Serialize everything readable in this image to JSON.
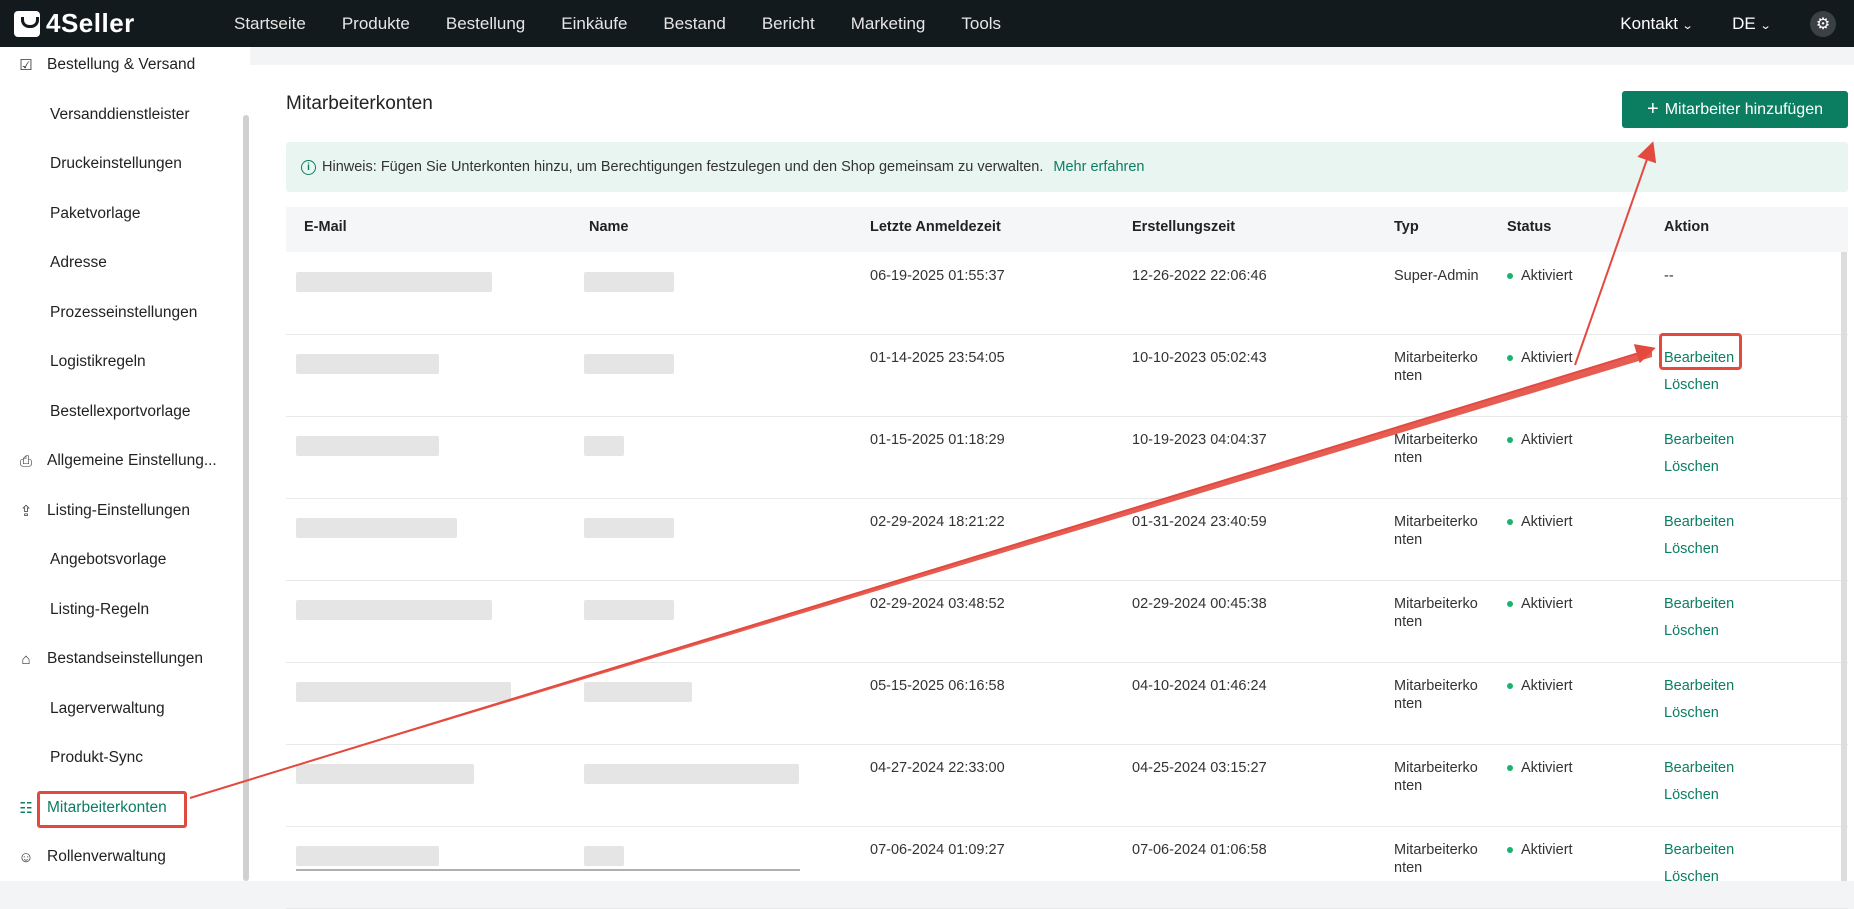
{
  "app": {
    "logo_text": "4Seller"
  },
  "topnav": {
    "items": [
      "Startseite",
      "Produkte",
      "Bestellung",
      "Einkäufe",
      "Bestand",
      "Bericht",
      "Marketing",
      "Tools"
    ],
    "contact": "Kontakt",
    "language": "DE"
  },
  "sidebar": {
    "items": [
      {
        "label": "Bestellung & Versand",
        "type": "group",
        "icon": "clipboard-icon"
      },
      {
        "label": "Versanddienstleister",
        "type": "sub"
      },
      {
        "label": "Druckeinstellungen",
        "type": "sub"
      },
      {
        "label": "Paketvorlage",
        "type": "sub"
      },
      {
        "label": "Adresse",
        "type": "sub"
      },
      {
        "label": "Prozesseinstellungen",
        "type": "sub"
      },
      {
        "label": "Logistikregeln",
        "type": "sub"
      },
      {
        "label": "Bestellexportvorlage",
        "type": "sub"
      },
      {
        "label": "Allgemeine Einstellung...",
        "type": "group",
        "icon": "printer-icon"
      },
      {
        "label": "Listing-Einstellungen",
        "type": "group",
        "icon": "upload-icon"
      },
      {
        "label": "Angebotsvorlage",
        "type": "sub"
      },
      {
        "label": "Listing-Regeln",
        "type": "sub"
      },
      {
        "label": "Bestandseinstellungen",
        "type": "group",
        "icon": "warehouse-icon"
      },
      {
        "label": "Lagerverwaltung",
        "type": "sub"
      },
      {
        "label": "Produkt-Sync",
        "type": "sub"
      },
      {
        "label": "Mitarbeiterkonten",
        "type": "group",
        "icon": "id-badge-icon",
        "active": true
      },
      {
        "label": "Rollenverwaltung",
        "type": "group",
        "icon": "user-icon"
      }
    ]
  },
  "main": {
    "title": "Mitarbeiterkonten",
    "add_button": "Mitarbeiter hinzufügen",
    "hint_text": "Hinweis: Fügen Sie Unterkonten hinzu, um Berechtigungen festzulegen und den Shop gemeinsam zu verwalten.",
    "hint_link": "Mehr erfahren"
  },
  "table": {
    "headers": [
      "E-Mail",
      "Name",
      "Letzte Anmeldezeit",
      "Erstellungszeit",
      "Typ",
      "Status",
      "Aktion"
    ],
    "rows": [
      {
        "last_login": "06-19-2025 01:55:37",
        "created": "12-26-2022 22:06:46",
        "type": "Super-Admin",
        "status": "Aktiviert",
        "action": "--"
      },
      {
        "last_login": "01-14-2025 23:54:05",
        "created": "10-10-2023 05:02:43",
        "type": "Mitarbeiterkonten",
        "status": "Aktiviert",
        "edit": "Bearbeiten",
        "delete": "Löschen"
      },
      {
        "last_login": "01-15-2025 01:18:29",
        "created": "10-19-2023 04:04:37",
        "type": "Mitarbeiterkonten",
        "status": "Aktiviert",
        "edit": "Bearbeiten",
        "delete": "Löschen"
      },
      {
        "last_login": "02-29-2024 18:21:22",
        "created": "01-31-2024 23:40:59",
        "type": "Mitarbeiterkonten",
        "status": "Aktiviert",
        "edit": "Bearbeiten",
        "delete": "Löschen"
      },
      {
        "last_login": "02-29-2024 03:48:52",
        "created": "02-29-2024 00:45:38",
        "type": "Mitarbeiterkonten",
        "status": "Aktiviert",
        "edit": "Bearbeiten",
        "delete": "Löschen"
      },
      {
        "last_login": "05-15-2025 06:16:58",
        "created": "04-10-2024 01:46:24",
        "type": "Mitarbeiterkonten",
        "status": "Aktiviert",
        "edit": "Bearbeiten",
        "delete": "Löschen"
      },
      {
        "last_login": "04-27-2024 22:33:00",
        "created": "04-25-2024 03:15:27",
        "type": "Mitarbeiterkonten",
        "status": "Aktiviert",
        "edit": "Bearbeiten",
        "delete": "Löschen"
      },
      {
        "last_login": "07-06-2024 01:09:27",
        "created": "07-06-2024 01:06:58",
        "type": "Mitarbeiterkonten",
        "status": "Aktiviert",
        "edit": "Bearbeiten",
        "delete": "Löschen"
      }
    ]
  },
  "colors": {
    "accent": "#0b7e62",
    "annotation": "#e34a3f",
    "topbar": "#131a1d"
  }
}
